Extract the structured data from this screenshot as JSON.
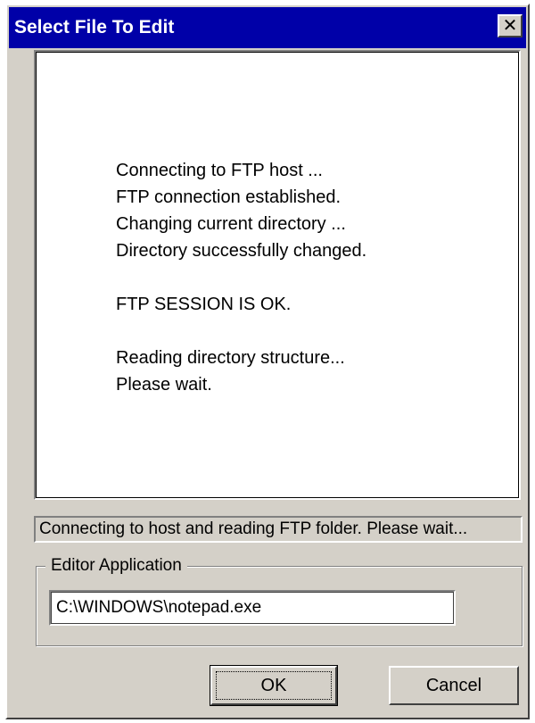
{
  "window": {
    "title": "Select File To Edit",
    "close_glyph": "✕"
  },
  "log": {
    "lines": [
      "Connecting to FTP host ...",
      "FTP connection established.",
      "Changing current directory ...",
      "Directory successfully changed.",
      "",
      "FTP SESSION IS OK.",
      "",
      "Reading directory structure...",
      "Please wait."
    ]
  },
  "status": {
    "text": "Connecting to host and reading FTP folder. Please wait..."
  },
  "editor": {
    "group_label": "Editor Application",
    "value": "C:\\WINDOWS\\notepad.exe"
  },
  "buttons": {
    "ok_label": "OK",
    "cancel_label": "Cancel"
  },
  "colors": {
    "titlebar": "#0000a8",
    "face": "#d4d0c8"
  }
}
